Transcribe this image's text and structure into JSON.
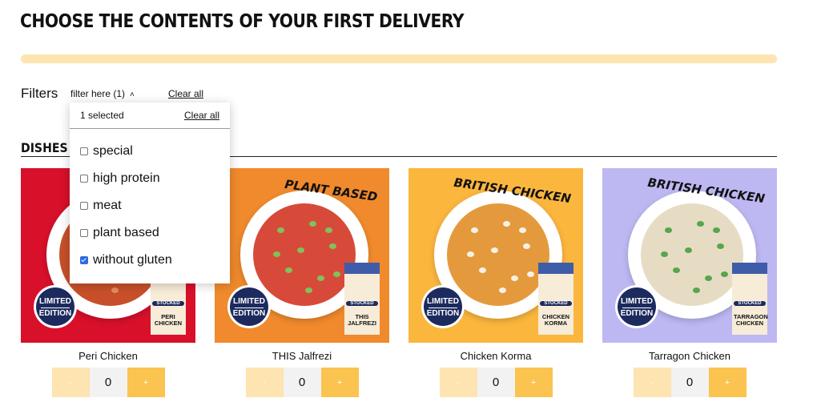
{
  "header": {
    "title": "CHOOSE THE CONTENTS OF YOUR FIRST DELIVERY",
    "progress_fraction": 1.0
  },
  "filters": {
    "label": "Filters",
    "toggle_label": "filter here (1)",
    "clear_all": "Clear all",
    "dropdown": {
      "selected_text": "1 selected",
      "clear_all": "Clear all",
      "options": [
        {
          "label": "special",
          "checked": false
        },
        {
          "label": "high protein",
          "checked": false
        },
        {
          "label": "meat",
          "checked": false
        },
        {
          "label": "plant based",
          "checked": false
        },
        {
          "label": "without gluten",
          "checked": true
        }
      ]
    }
  },
  "section": {
    "title": "DISHES"
  },
  "badge": {
    "line1": "LIMITED",
    "line2": "EDITION"
  },
  "pack_brand": "STOCKED",
  "dishes": [
    {
      "name": "Peri Chicken",
      "quantity": "0",
      "minus": "-",
      "plus": "+",
      "callout": "",
      "pack_label": "PERI CHICKEN",
      "bg": "#d8102a",
      "food": "#c7502a",
      "dots": "#e88b5c"
    },
    {
      "name": "THIS Jalfrezi",
      "quantity": "0",
      "minus": "-",
      "plus": "+",
      "callout": "PLANT BASED",
      "pack_label": "THIS JALFREZI",
      "bg": "#f08a2c",
      "food": "#d74a3a",
      "dots": "#7fc25a"
    },
    {
      "name": "Chicken Korma",
      "quantity": "0",
      "minus": "-",
      "plus": "+",
      "callout": "BRITISH CHICKEN",
      "pack_label": "CHICKEN KORMA",
      "bg": "#fbb63e",
      "food": "#e49a3c",
      "dots": "#f6f1e6"
    },
    {
      "name": "Tarragon Chicken",
      "quantity": "0",
      "minus": "-",
      "plus": "+",
      "callout": "BRITISH CHICKEN",
      "pack_label": "TARRAGON CHICKEN",
      "bg": "#bdb8f2",
      "food": "#e6dcc4",
      "dots": "#58a54a"
    }
  ]
}
